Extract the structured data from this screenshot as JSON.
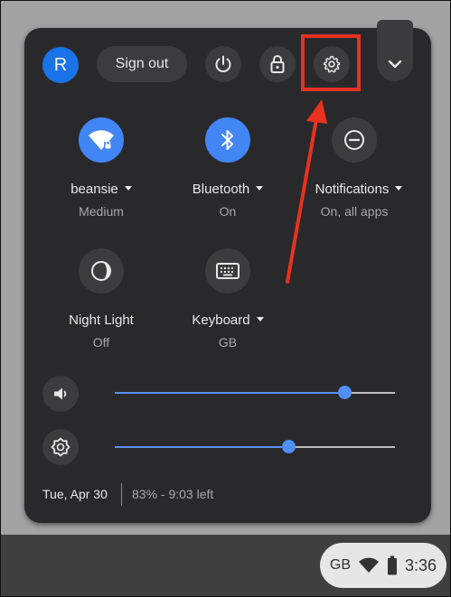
{
  "header": {
    "avatar_initial": "R",
    "sign_out_label": "Sign out"
  },
  "tiles": [
    {
      "label": "beansie",
      "sub": "Medium",
      "icon": "wifi-icon",
      "active": true,
      "has_menu": true
    },
    {
      "label": "Bluetooth",
      "sub": "On",
      "icon": "bluetooth-icon",
      "active": true,
      "has_menu": true
    },
    {
      "label": "Notifications",
      "sub": "On, all apps",
      "icon": "do-not-disturb-icon",
      "active": false,
      "has_menu": true
    },
    {
      "label": "Night Light",
      "sub": "Off",
      "icon": "night-light-icon",
      "active": false,
      "has_menu": false
    },
    {
      "label": "Keyboard",
      "sub": "GB",
      "icon": "keyboard-icon",
      "active": false,
      "has_menu": true
    }
  ],
  "sliders": {
    "volume": 0.82,
    "brightness": 0.62
  },
  "footer": {
    "date": "Tue, Apr 30",
    "battery": "83% - 9:03 left"
  },
  "tray": {
    "keyboard_layout": "GB",
    "time": "3:36"
  },
  "colors": {
    "accent": "#4285f4",
    "annotation": "#e8321f",
    "panel": "#29292c"
  }
}
